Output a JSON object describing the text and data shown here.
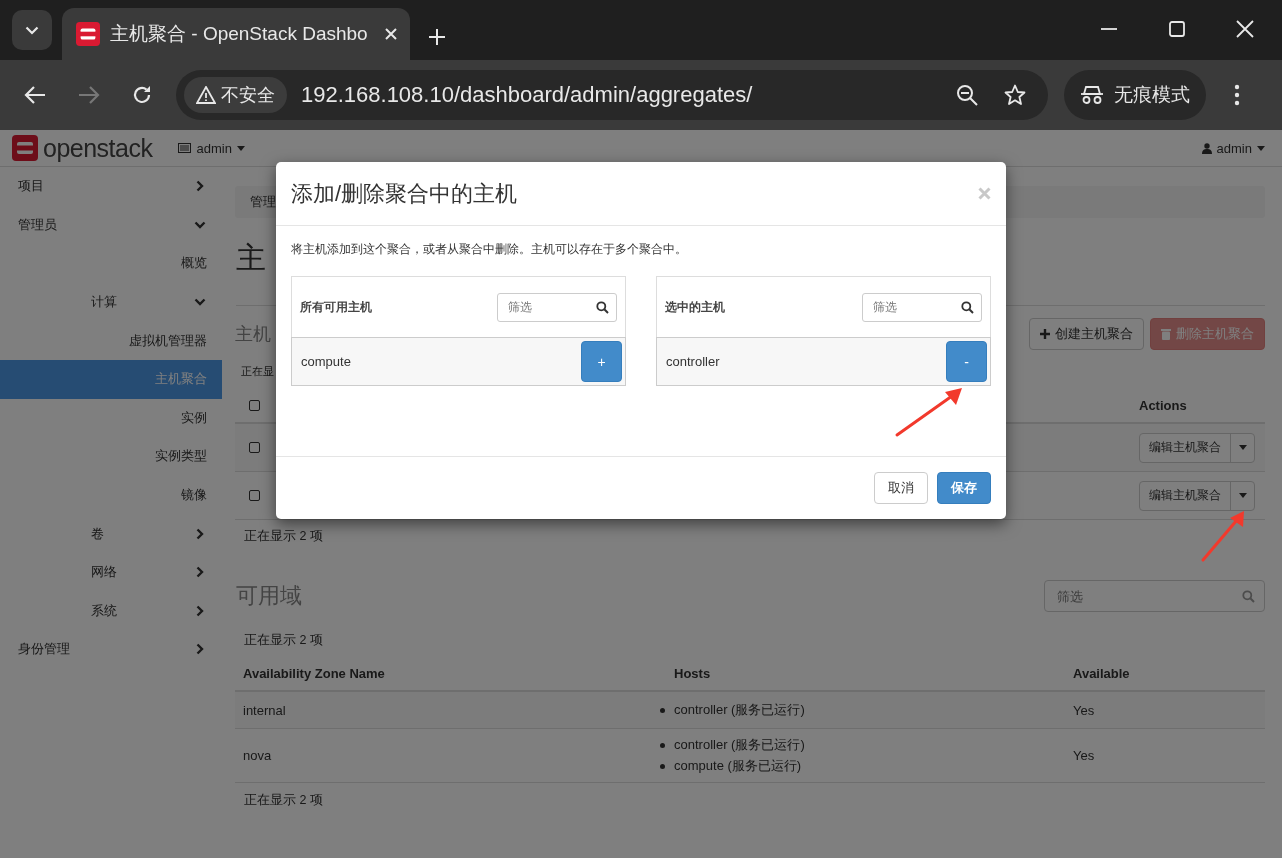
{
  "browser": {
    "tab_title": "主机聚合 - OpenStack Dashbo",
    "security": "不安全",
    "url": "192.168.108.10/dashboard/admin/aggregates/",
    "profile": "无痕模式"
  },
  "header": {
    "brand": "openstack",
    "project": "admin",
    "user": "admin"
  },
  "sidebar": {
    "items": [
      {
        "kind": "group",
        "label": "项目",
        "expanded": false
      },
      {
        "kind": "group",
        "label": "管理员",
        "expanded": true,
        "children": [
          {
            "kind": "link",
            "label": "概览",
            "selected": false
          },
          {
            "kind": "group",
            "label": "计算",
            "expanded": true,
            "children": [
              {
                "kind": "link",
                "label": "虚拟机管理器",
                "selected": false
              },
              {
                "kind": "link",
                "label": "主机聚合",
                "selected": true
              },
              {
                "kind": "link",
                "label": "实例",
                "selected": false
              },
              {
                "kind": "link",
                "label": "实例类型",
                "selected": false
              },
              {
                "kind": "link",
                "label": "镜像",
                "selected": false
              }
            ]
          },
          {
            "kind": "group",
            "label": "卷",
            "expanded": false
          },
          {
            "kind": "group",
            "label": "网络",
            "expanded": false
          },
          {
            "kind": "group",
            "label": "系统",
            "expanded": false
          }
        ]
      },
      {
        "kind": "group",
        "label": "身份管理",
        "expanded": false
      }
    ]
  },
  "main": {
    "breadcrumb": "管理",
    "page_title": "主",
    "aggregates": {
      "heading": "主机",
      "buttons": [
        {
          "kind": "create",
          "label": "创建主机聚合",
          "disabled": false
        },
        {
          "kind": "delete",
          "label": "删除主机聚合",
          "disabled": true
        }
      ],
      "count_top": "正在显",
      "select_all_checked": false,
      "actions_header": "Actions",
      "rows": [
        {
          "checked": false,
          "action": "编辑主机聚合"
        },
        {
          "checked": false,
          "action": "编辑主机聚合"
        }
      ],
      "count_bottom": "正在显示 2 项"
    },
    "zones": {
      "heading": "可用域",
      "filter_placeholder": "筛选",
      "count_top": "正在显示 2 项",
      "columns": [
        "Availability Zone Name",
        "Hosts",
        "Available"
      ],
      "rows": [
        {
          "name": "internal",
          "hosts": [
            "controller (服务已运行)"
          ],
          "available": "Yes"
        },
        {
          "name": "nova",
          "hosts": [
            "controller (服务已运行)",
            "compute (服务已运行)"
          ],
          "available": "Yes"
        }
      ],
      "count_bottom": "正在显示 2 项"
    }
  },
  "modal": {
    "title": "添加/删除聚合中的主机",
    "description": "将主机添加到这个聚合，或者从聚合中删除。主机可以存在于多个聚合中。",
    "panels": [
      {
        "title": "所有可用主机",
        "filter_placeholder": "筛选",
        "hosts": [
          {
            "name": "compute",
            "action": "+"
          }
        ]
      },
      {
        "title": "选中的主机",
        "filter_placeholder": "筛选",
        "hosts": [
          {
            "name": "controller",
            "action": "-"
          }
        ]
      }
    ],
    "cancel": "取消",
    "save": "保存"
  }
}
